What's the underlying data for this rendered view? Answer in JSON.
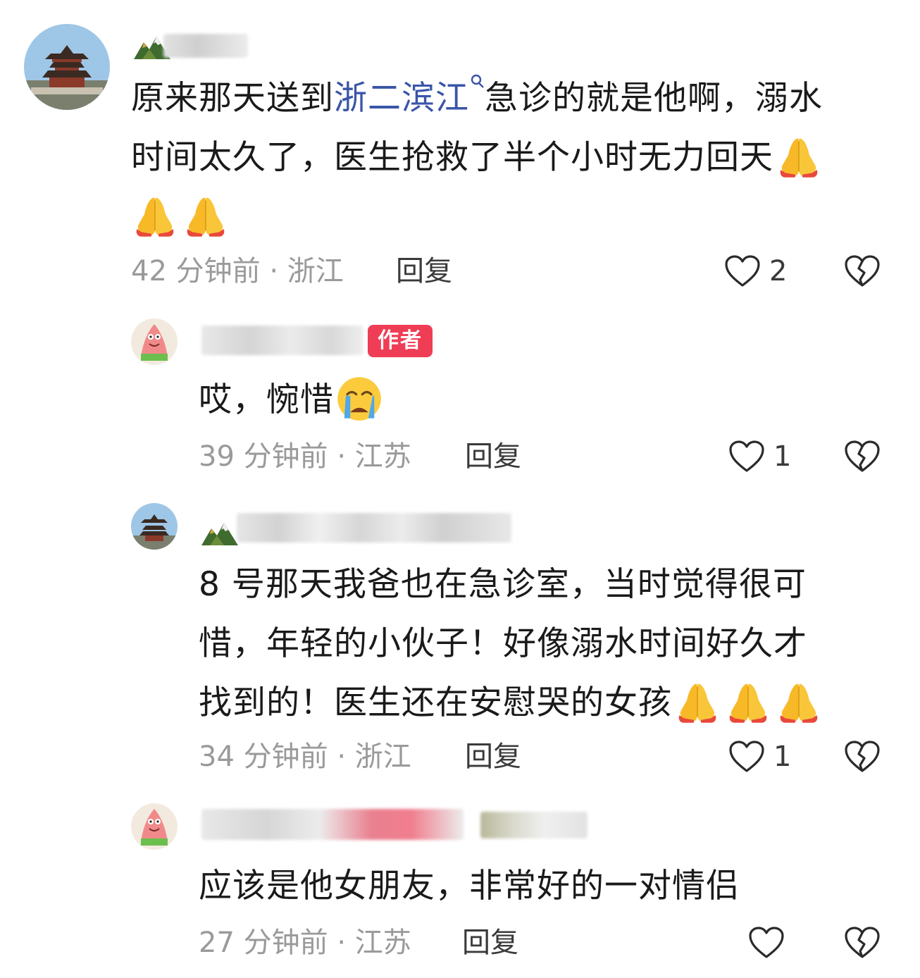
{
  "comments": [
    {
      "text_before_link": "原来那天送到",
      "link": "浙二滨江",
      "text_after_link": "急诊的就是他啊，溺水",
      "line2": "时间太久了，医生抢救了半个小时无力回天",
      "time_location": "42 分钟前 · 浙江",
      "reply_label": "回复",
      "likes": "2",
      "emojis": [
        "pray",
        "pray",
        "pray"
      ]
    },
    {
      "author_badge": "作者",
      "text": "哎，惋惜",
      "time_location": "39 分钟前 · 江苏",
      "reply_label": "回复",
      "likes": "1",
      "emojis": [
        "crying-face"
      ]
    },
    {
      "line1": "8 号那天我爸也在急诊室，当时觉得很可",
      "line2": "惜，年轻的小伙子！好像溺水时间好久才",
      "line3": "找到的！医生还在安慰哭的女孩",
      "time_location": "34 分钟前 · 浙江",
      "reply_label": "回复",
      "likes": "1",
      "emojis": [
        "pray",
        "pray",
        "pray"
      ]
    },
    {
      "text": "应该是他女朋友，非常好的一对情侣",
      "time_location": "27 分钟前 · 江苏",
      "reply_label": "回复",
      "likes": ""
    }
  ],
  "colors": {
    "link": "#3a55a8",
    "author_badge": "#ef3d55",
    "meta_text": "#9a9a9a"
  }
}
